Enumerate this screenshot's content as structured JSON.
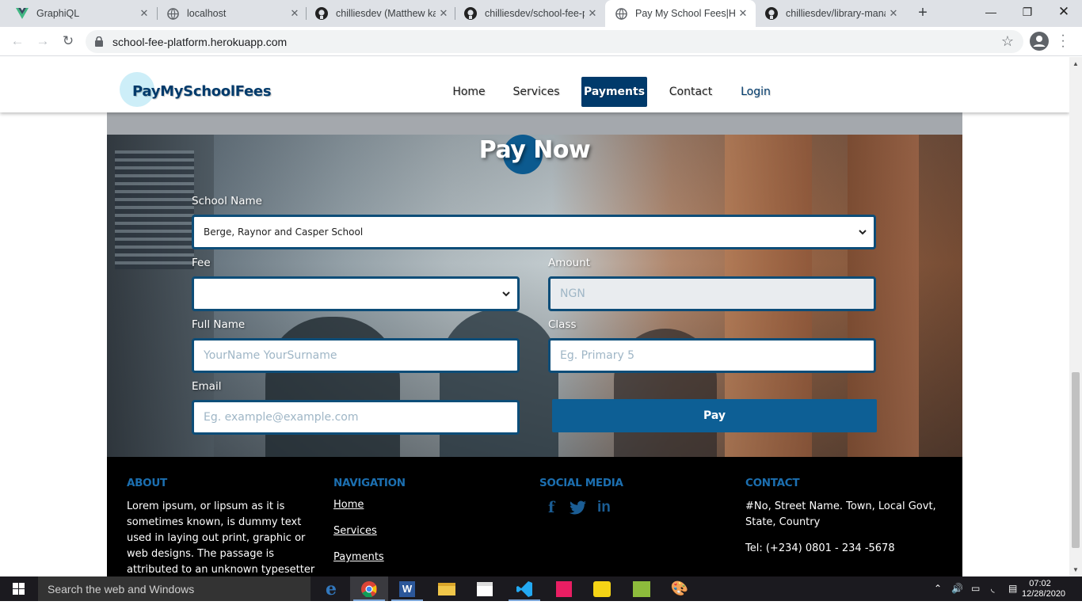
{
  "browser": {
    "tabs": [
      {
        "title": "GraphiQL",
        "icon": "vue-icon",
        "active": false
      },
      {
        "title": "localhost",
        "icon": "globe-icon",
        "active": false
      },
      {
        "title": "chilliesdev (Matthew ka",
        "icon": "github-icon",
        "active": false
      },
      {
        "title": "chilliesdev/school-fee-p",
        "icon": "github-icon",
        "active": false
      },
      {
        "title": "Pay My School Fees|Ho",
        "icon": "globe-icon",
        "active": true
      },
      {
        "title": "chilliesdev/library-mana",
        "icon": "github-icon",
        "active": false
      }
    ],
    "new_tab": "+",
    "url": "school-fee-platform.herokuapp.com"
  },
  "site": {
    "logo": "PayMySchoolFees",
    "nav": [
      {
        "label": "Home"
      },
      {
        "label": "Services"
      },
      {
        "label": "Payments",
        "active": true
      },
      {
        "label": "Contact"
      },
      {
        "label": "Login"
      }
    ]
  },
  "form": {
    "title": "Pay Now",
    "school_label": "School Name",
    "school_value": "Berge, Raynor and Casper School",
    "fee_label": "Fee",
    "fee_value": "",
    "amount_label": "Amount",
    "amount_placeholder": "NGN",
    "fullname_label": "Full Name",
    "fullname_placeholder": "YourName YourSurname",
    "class_label": "Class",
    "class_placeholder": "Eg. Primary 5",
    "email_label": "Email",
    "email_placeholder": "Eg. example@example.com",
    "pay_button": "Pay"
  },
  "footer": {
    "about_heading": "ABOUT",
    "about_lines": [
      "Lorem ipsum, or lipsum as it is",
      "sometimes known, is dummy text",
      "used in laying out print, graphic or",
      "web designs. The passage is",
      "attributed to an unknown typesetter"
    ],
    "nav_heading": "NAVIGATION",
    "nav_links": [
      "Home",
      "Services",
      "Payments"
    ],
    "social_heading": "SOCIAL MEDIA",
    "contact_heading": "CONTACT",
    "address_lines": [
      "#No, Street Name. Town, Local Govt,",
      "State, Country"
    ],
    "tel": "Tel: (+234) 0801 - 234 -5678"
  },
  "taskbar": {
    "search_placeholder": "Search the web and Windows",
    "time": "07:02",
    "date": "12/28/2020"
  },
  "colors": {
    "brand": "#003a6b",
    "button": "#0d5f95",
    "footer_heading": "#1c6fb0"
  }
}
